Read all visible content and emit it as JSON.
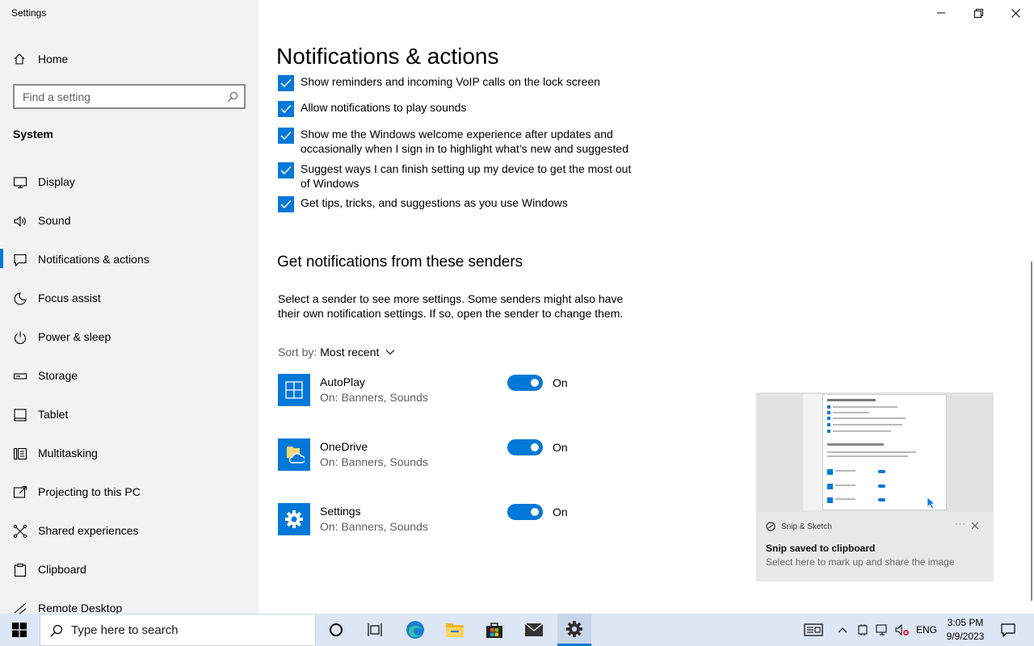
{
  "app": {
    "title": "Settings"
  },
  "sidebar": {
    "home_label": "Home",
    "search_placeholder": "Find a setting",
    "group_label": "System",
    "items": [
      {
        "label": "Display",
        "icon": "monitor-icon"
      },
      {
        "label": "Sound",
        "icon": "speaker-icon"
      },
      {
        "label": "Notifications & actions",
        "icon": "notification-icon",
        "active": true
      },
      {
        "label": "Focus assist",
        "icon": "moon-icon"
      },
      {
        "label": "Power & sleep",
        "icon": "power-icon"
      },
      {
        "label": "Storage",
        "icon": "storage-icon"
      },
      {
        "label": "Tablet",
        "icon": "tablet-icon"
      },
      {
        "label": "Multitasking",
        "icon": "multitasking-icon"
      },
      {
        "label": "Projecting to this PC",
        "icon": "projecting-icon"
      },
      {
        "label": "Shared experiences",
        "icon": "shared-icon"
      },
      {
        "label": "Clipboard",
        "icon": "clipboard-icon"
      },
      {
        "label": "Remote Desktop",
        "icon": "remote-desktop-icon"
      }
    ]
  },
  "main": {
    "title": "Notifications & actions",
    "checkboxes": [
      {
        "label": "Show reminders and incoming VoIP calls on the lock screen",
        "checked": true
      },
      {
        "label": "Allow notifications to play sounds",
        "checked": true
      },
      {
        "label": "Show me the Windows welcome experience after updates and occasionally when I sign in to highlight what’s new and suggested",
        "checked": true
      },
      {
        "label": "Suggest ways I can finish setting up my device to get the most out of Windows",
        "checked": true
      },
      {
        "label": "Get tips, tricks, and suggestions as you use Windows",
        "checked": true
      }
    ],
    "senders_title": "Get notifications from these senders",
    "senders_desc": "Select a sender to see more settings. Some senders might also have their own notification settings. If so, open the sender to change them.",
    "sort_label": "Sort by:",
    "sort_value": "Most recent",
    "senders": [
      {
        "name": "AutoPlay",
        "sub": "On: Banners, Sounds",
        "state": "On",
        "icon": "autoplay-icon"
      },
      {
        "name": "OneDrive",
        "sub": "On: Banners, Sounds",
        "state": "On",
        "icon": "onedrive-icon"
      },
      {
        "name": "Settings",
        "sub": "On: Banners, Sounds",
        "state": "On",
        "icon": "settings-gear-icon"
      }
    ]
  },
  "toast": {
    "app_name": "Snip & Sketch",
    "title": "Snip saved to clipboard",
    "body": "Select here to mark up and share the image"
  },
  "taskbar": {
    "search_placeholder": "Type here to search",
    "language": "ENG",
    "time": "3:05 PM",
    "date": "9/9/2023"
  },
  "colors": {
    "accent": "#0078d7",
    "sidebar_bg": "#f2f2f2",
    "taskbar_bg": "#dde6f4"
  }
}
